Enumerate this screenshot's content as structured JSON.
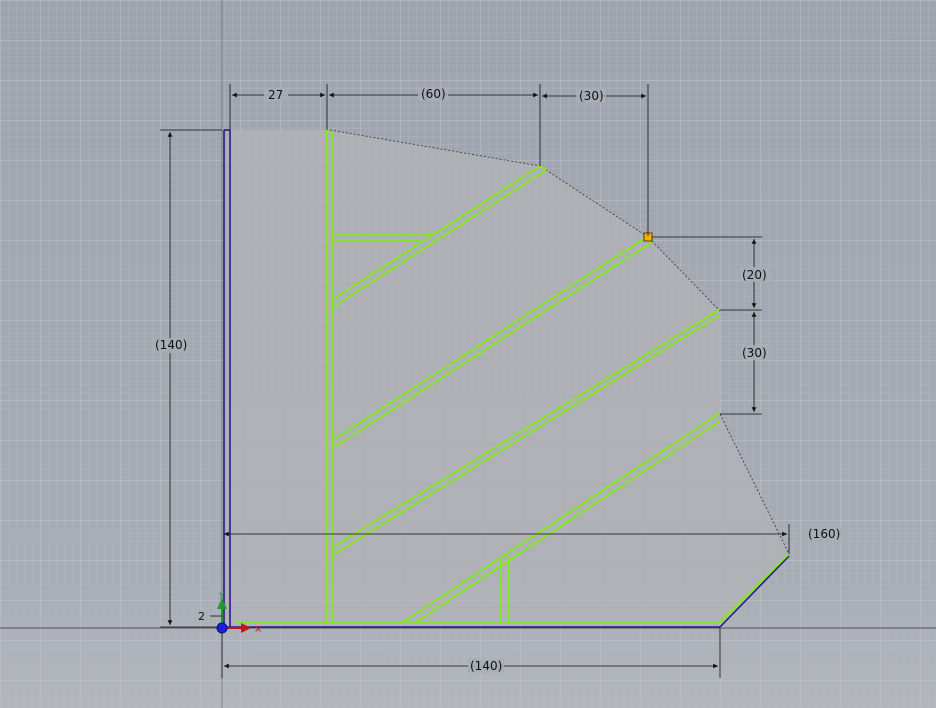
{
  "dimensions": {
    "top_width_1": "27",
    "top_width_2": "(60)",
    "top_width_3": "(30)",
    "left_height": "(140)",
    "right_height_1": "(20)",
    "right_height_2": "(30)",
    "overall_width": "(160)",
    "bottom_width": "(140)"
  },
  "origin": {
    "axis_label": "2"
  },
  "colors": {
    "background": "#a9adb6",
    "grid": "#b9bcc4",
    "profile_green": "#7df200",
    "construction_blue": "#2a1a86",
    "selection_point": "#f2b300",
    "axis_x": "#c0161c",
    "axis_y": "#1f9a31",
    "origin_dot": "#1b20d6"
  },
  "icons": {
    "origin": "ucs-origin-icon",
    "selected_vertex": "vertex-marker-icon"
  }
}
